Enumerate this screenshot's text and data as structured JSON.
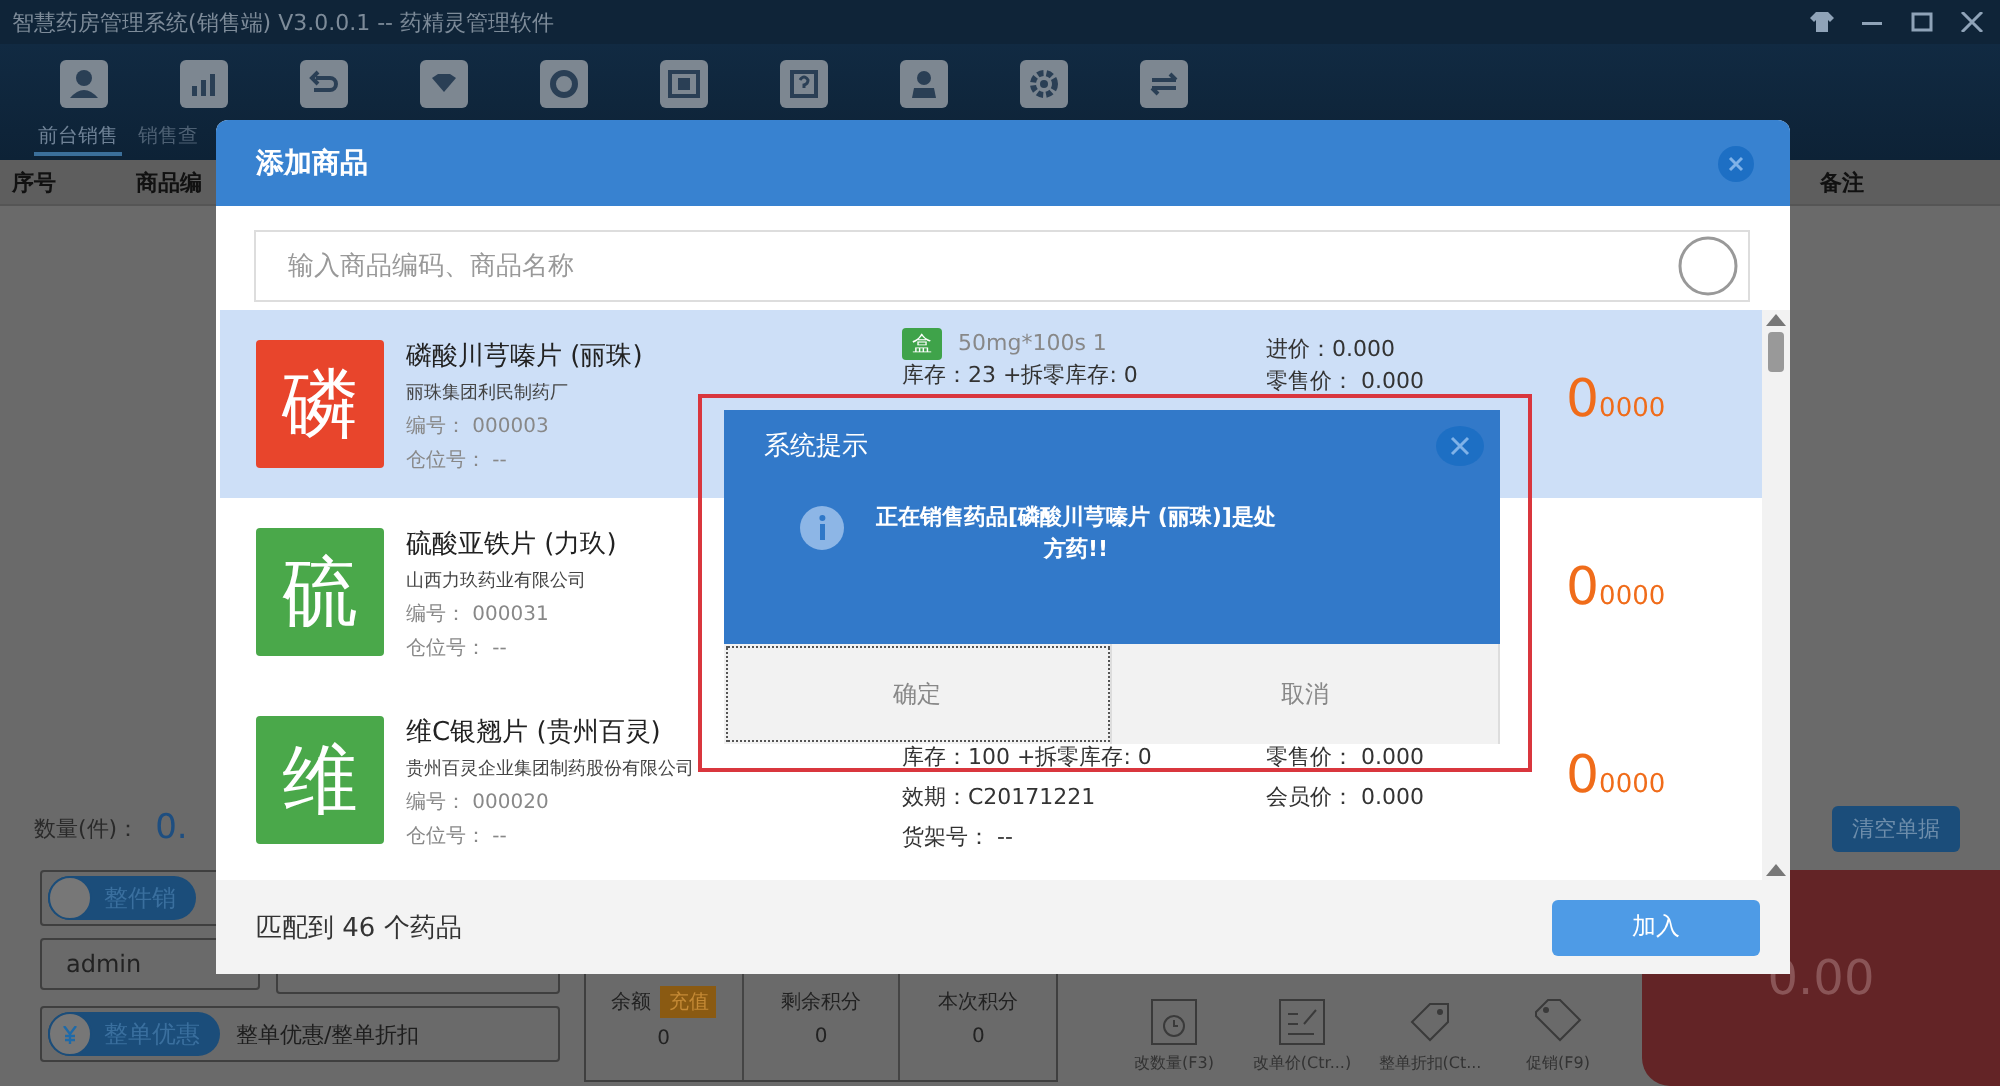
{
  "window": {
    "title": "智慧药房管理系统(销售端)  V3.0.0.1 -- 药精灵管理软件"
  },
  "tabs": [
    {
      "label": "前台销售",
      "selected": true
    },
    {
      "label": "销售查",
      "selected": false
    }
  ],
  "table": {
    "columns": [
      "序号",
      "商品编",
      "备注"
    ]
  },
  "summary": {
    "quantity_label": "数量(件)：",
    "quantity_value": "0.",
    "clear_button": "清空单据"
  },
  "sale_mode": {
    "label": "整件销"
  },
  "operator": {
    "value": "admin"
  },
  "member": {
    "cells": [
      {
        "label": "余额",
        "badge": "充值",
        "value": "0"
      },
      {
        "label": "剩余积分",
        "value": "0"
      },
      {
        "label": "本次积分",
        "value": "0"
      }
    ]
  },
  "discount": {
    "label": "整单优惠",
    "placeholder": "整单优惠/整单折扣"
  },
  "actions": [
    "改数量(F3)",
    "改单价(Ctr...)",
    "整单折扣(Ct...",
    "促销(F9)"
  ],
  "total": {
    "value": "0.00"
  },
  "modal": {
    "title": "添加商品",
    "search_placeholder": "输入商品编码、商品名称",
    "items": [
      {
        "selected": true,
        "initial": "磷",
        "color": "#e8452c",
        "name": "磷酸川芎嗪片 (丽珠)",
        "maker": "丽珠集团利民制药厂",
        "code": "编号： 000003",
        "location": "仓位号：  --",
        "mid": [
          {
            "badge": "盒",
            "text": "50mg*100s  1"
          },
          {
            "text": "库存：23 +拆零库存: 0"
          }
        ],
        "right": [
          "进价：0.000",
          "零售价： 0.000"
        ],
        "price": "0",
        "price_fraction": "0000"
      },
      {
        "selected": false,
        "initial": "硫",
        "color": "#4aa84a",
        "name": "硫酸亚铁片 (力玖)",
        "maker": "山西力玖药业有限公司",
        "code": "编号： 000031",
        "location": "仓位号：  --",
        "price": "0",
        "price_fraction": "0000"
      },
      {
        "selected": false,
        "initial": "维",
        "color": "#4aa84a",
        "name": "维C银翘片 (贵州百灵)",
        "maker": "贵州百灵企业集团制药股份有限公司",
        "code": "编号： 000020",
        "location": "仓位号：  --",
        "mid": [
          {
            "text": "库存：100 +拆零库存: 0"
          },
          {
            "text": "效期：C20171221"
          },
          {
            "text": "货架号：  --"
          }
        ],
        "right": [
          "零售价： 0.000",
          "会员价： 0.000"
        ],
        "price": "0",
        "price_fraction": "0000"
      }
    ],
    "match_count": "匹配到 46 个药品",
    "add_button": "加入"
  },
  "alert": {
    "title": "系统提示",
    "message": "正在销售药品[磷酸川芎嗪片 (丽珠)]是处方药!!",
    "buttons": [
      {
        "label": "确定",
        "focused": true
      },
      {
        "label": "取消",
        "focused": false
      }
    ]
  }
}
